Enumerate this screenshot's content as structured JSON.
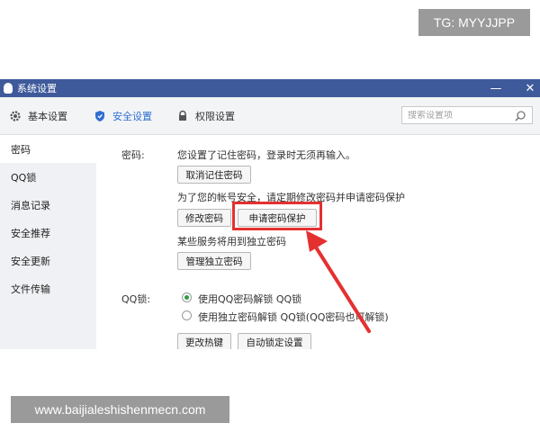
{
  "badges": {
    "tg": "TG: MYYJJPP",
    "watermark": "www.baijialeshishenmecn.com"
  },
  "window": {
    "title": "系统设置",
    "minimize": "—",
    "close": "✕"
  },
  "tabs": [
    {
      "label": "基本设置",
      "icon": "gear-icon"
    },
    {
      "label": "安全设置",
      "icon": "shield-icon",
      "active": true
    },
    {
      "label": "权限设置",
      "icon": "lock-icon"
    }
  ],
  "search": {
    "placeholder": "搜索设置项",
    "icon": "search-icon"
  },
  "sidebar": {
    "items": [
      {
        "label": "密码",
        "active": true
      },
      {
        "label": "QQ锁"
      },
      {
        "label": "消息记录"
      },
      {
        "label": "安全推荐"
      },
      {
        "label": "安全更新"
      },
      {
        "label": "文件传输"
      }
    ]
  },
  "password": {
    "label": "密码:",
    "remembered_text": "您设置了记住密码，登录时无须再输入。",
    "cancel_remember_button": "取消记住密码",
    "security_hint": "为了您的帐号安全，请定期修改密码并申请密码保护",
    "change_password_button": "修改密码",
    "apply_protection_button": "申请密码保护",
    "independent_text": "某些服务将用到独立密码",
    "manage_independent_button": "管理独立密码"
  },
  "qqlock": {
    "label": "QQ锁:",
    "option1": "使用QQ密码解锁 QQ锁",
    "option2": "使用独立密码解锁 QQ锁(QQ密码也可解锁)",
    "hotkey_button": "更改热键",
    "autolock_button": "自动锁定设置"
  },
  "colors": {
    "titlebar": "#3e5a9a",
    "accent": "#2f6fd3",
    "highlight": "#e53030"
  }
}
